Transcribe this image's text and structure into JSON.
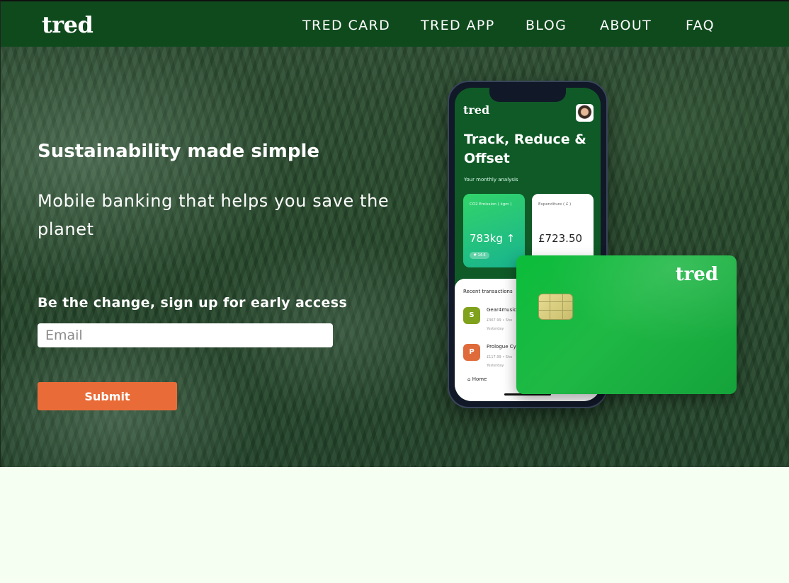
{
  "nav": {
    "logo": "tred",
    "links": [
      "TRED CARD",
      "TRED APP",
      "BLOG",
      "ABOUT",
      "FAQ"
    ]
  },
  "hero": {
    "title": "Sustainability made simple",
    "subtitle": "Mobile banking that helps you save the planet",
    "signup_label": "Be the change, sign up for early access",
    "email_placeholder": "Email",
    "submit_label": "Submit"
  },
  "phone": {
    "logo": "tred",
    "title": "Track, Reduce & Offset",
    "analysis": "Your monthly analysis",
    "card1": {
      "label": "CO2 Emission ( kgm )",
      "value": "783kg ↑",
      "chip": "♥ 14.6"
    },
    "card2": {
      "label": "Expenditure ( £ )",
      "value": "£723.50"
    },
    "recent_label": "Recent transactions",
    "transactions": [
      {
        "initial": "S",
        "name": "Gear4music",
        "sub": "£367.99 • Sho",
        "date": "Yesterday"
      },
      {
        "initial": "P",
        "name": "Prologue Cy",
        "sub": "£117.99 • Sho",
        "date": "Yesterday"
      }
    ],
    "home_label": "Home"
  },
  "card": {
    "logo": "tred"
  },
  "colors": {
    "nav_bg": "#0f4a1d",
    "accent": "#e96c38",
    "card_green": "#1fb845",
    "page_bg": "#f5fff2"
  },
  "icons": [
    "home-icon",
    "card-chip-icon",
    "avatar"
  ]
}
